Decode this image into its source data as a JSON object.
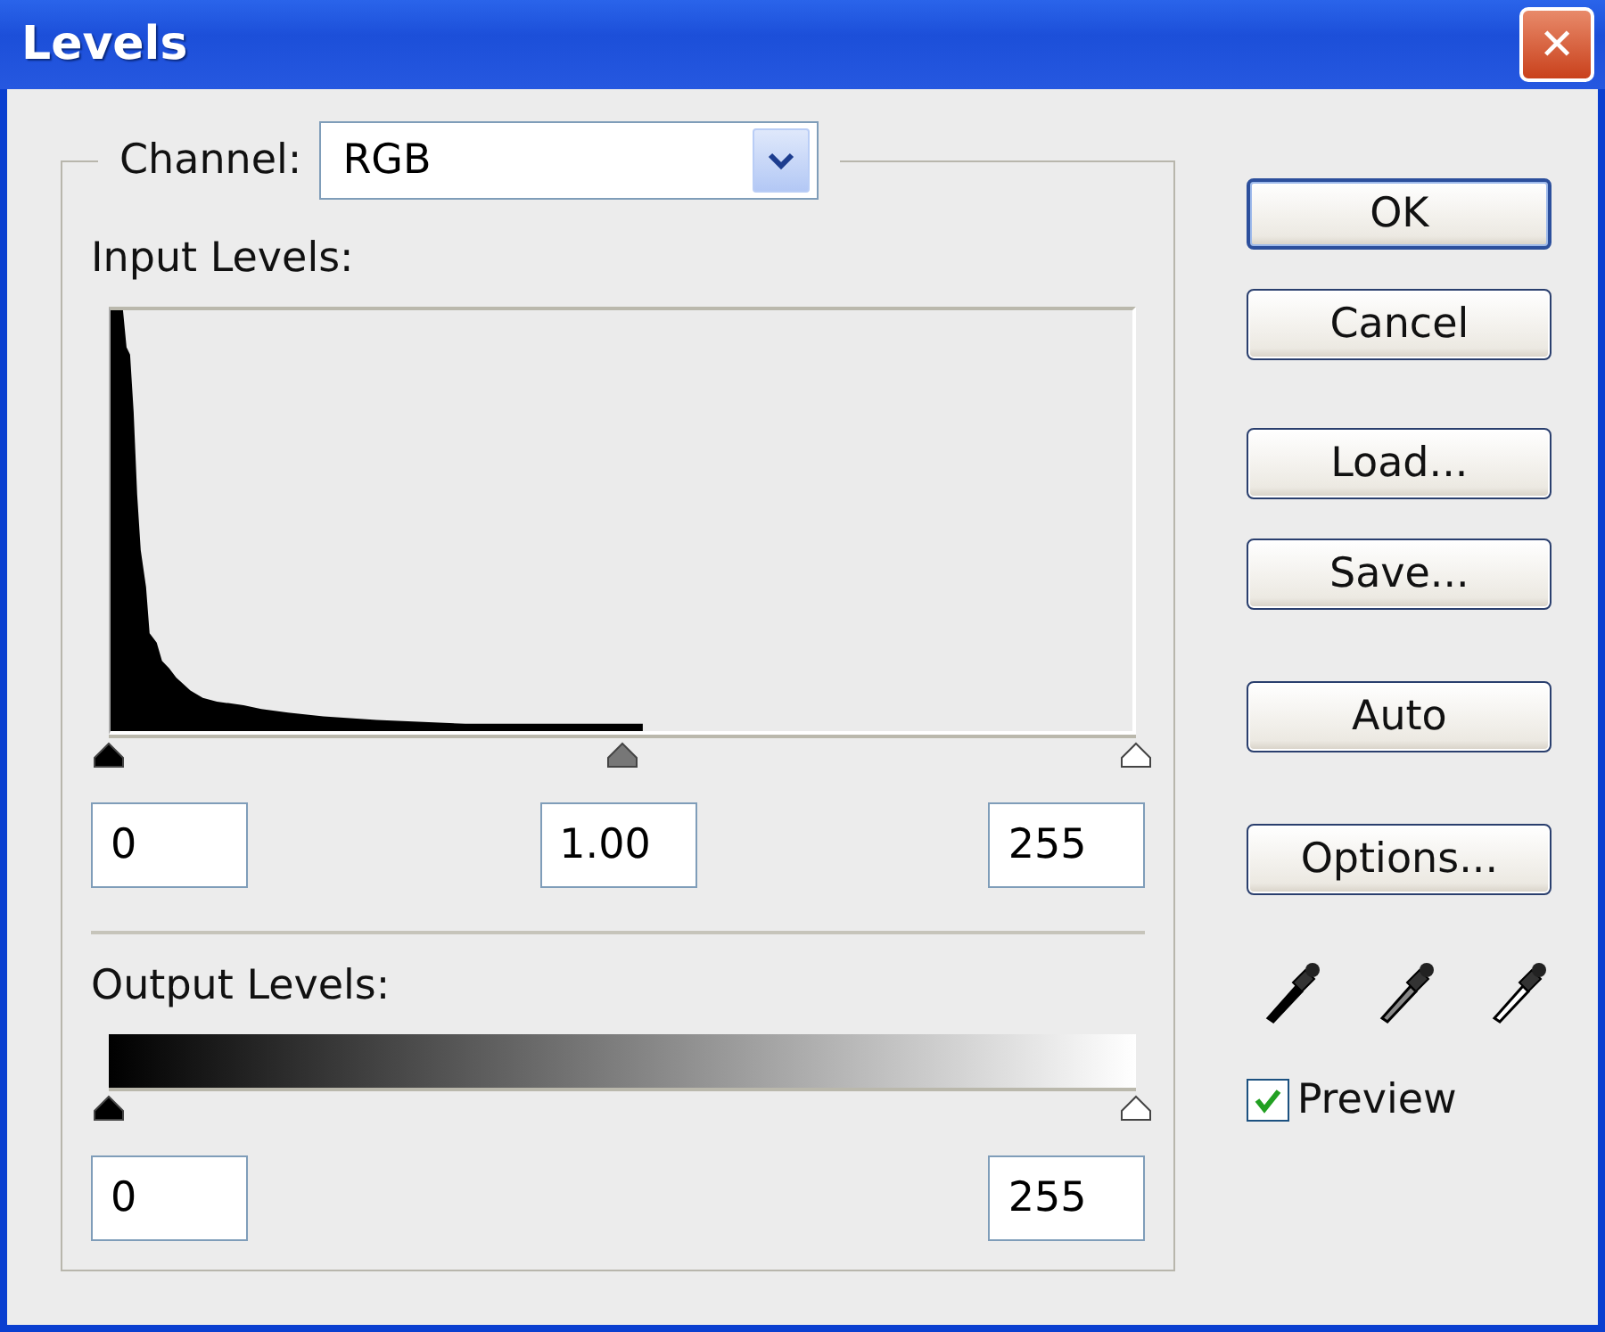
{
  "window": {
    "title": "Levels",
    "close": "✕"
  },
  "channel": {
    "label": "Channel:",
    "value": "RGB"
  },
  "input_levels": {
    "label": "Input Levels:",
    "thumbs": [
      {
        "kind": "black",
        "level": 0
      },
      {
        "kind": "gray",
        "level": 0.5
      },
      {
        "kind": "white",
        "level": 1
      }
    ],
    "fields": [
      "0",
      "1.00",
      "255"
    ]
  },
  "output_levels": {
    "label": "Output Levels:",
    "thumbs": [
      {
        "kind": "black",
        "level": 0
      },
      {
        "kind": "white",
        "level": 1
      }
    ],
    "fields": [
      "0",
      "255"
    ]
  },
  "buttons": [
    {
      "label": "OK",
      "default": true
    },
    {
      "label": "Cancel",
      "default": false
    },
    {
      "label": "Load...",
      "default": false
    },
    {
      "label": "Save...",
      "default": false
    },
    {
      "label": "Auto",
      "default": false
    },
    {
      "label": "Options...",
      "default": false
    }
  ],
  "eyedroppers": [
    {
      "kind": "black"
    },
    {
      "kind": "gray"
    },
    {
      "kind": "white"
    }
  ],
  "preview": {
    "label": "Preview",
    "checked": true
  }
}
